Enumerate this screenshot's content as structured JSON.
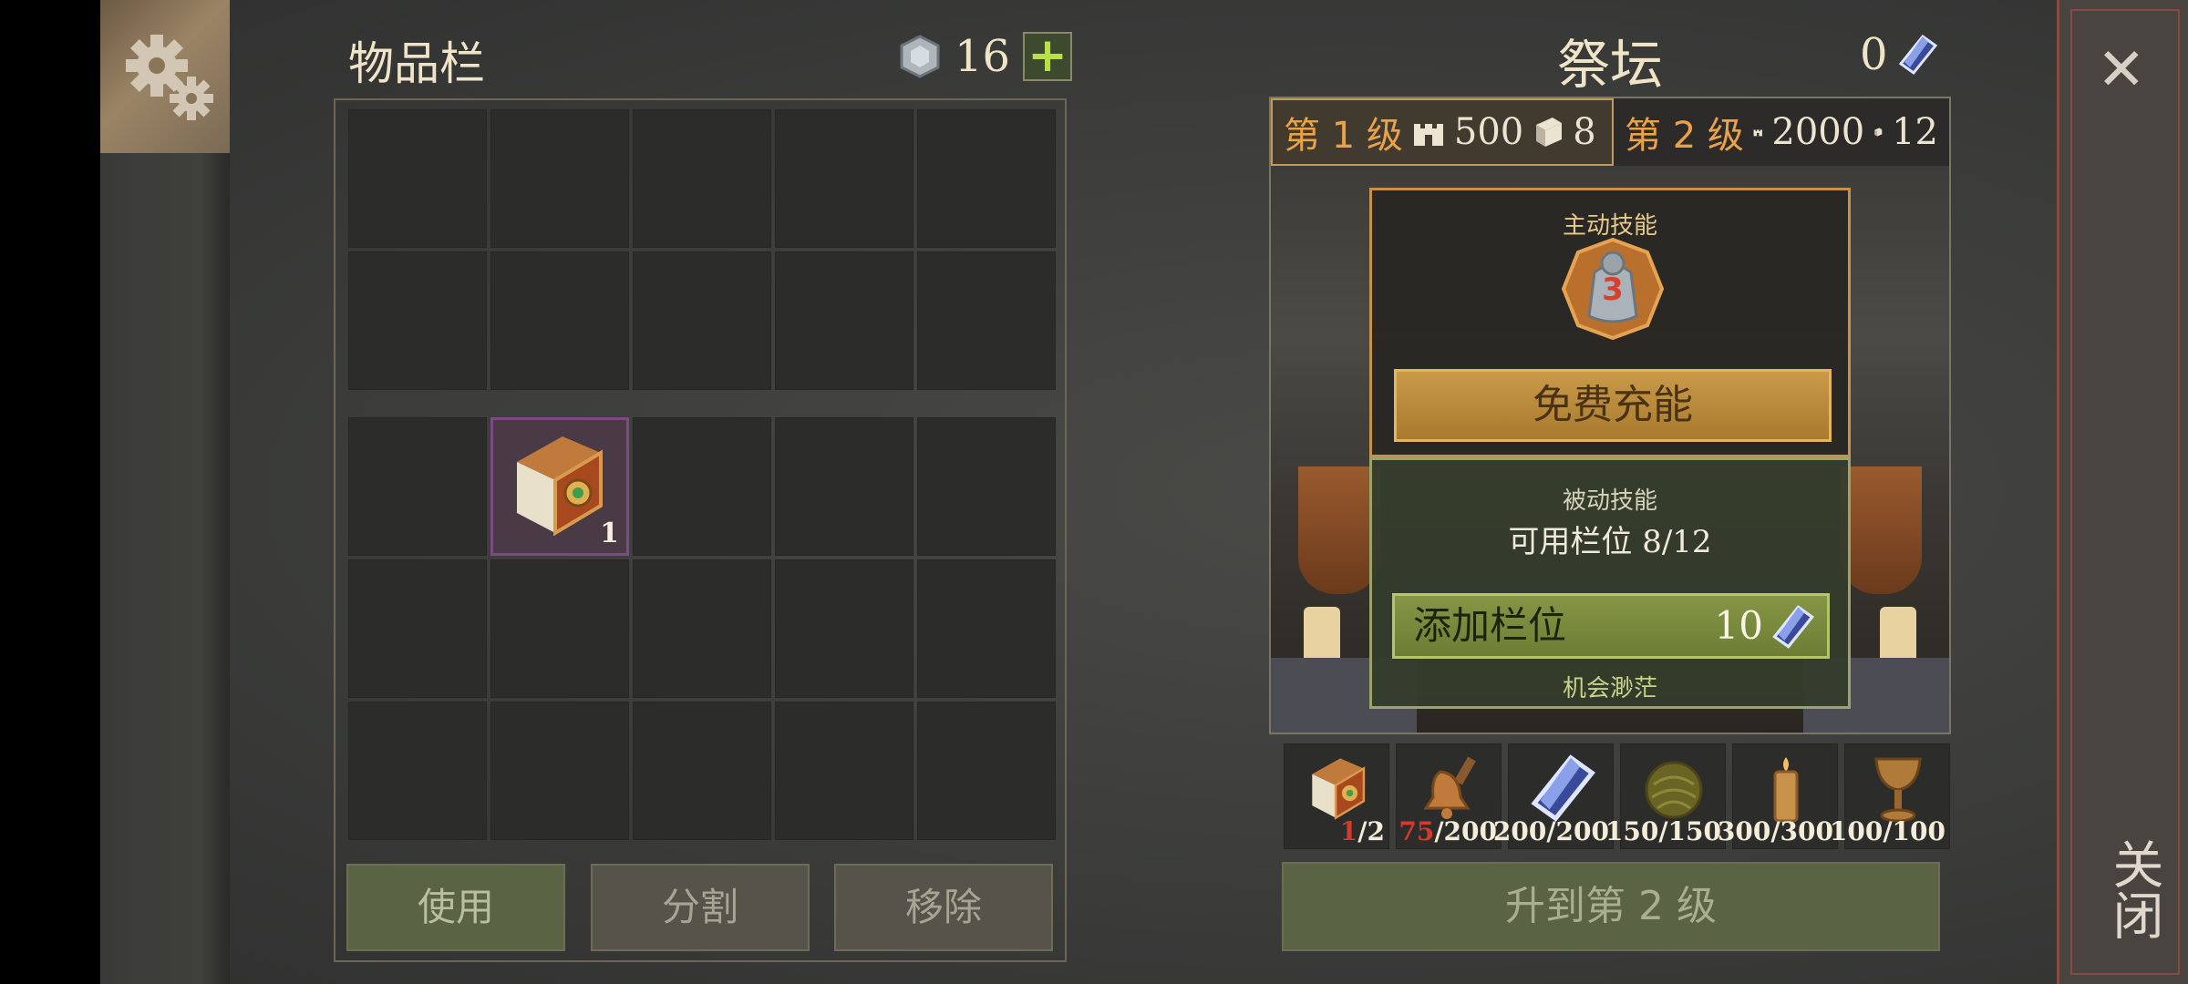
{
  "inventory": {
    "title": "物品栏",
    "gems": "16",
    "plus_label": "+",
    "book_qty": "1",
    "actions": {
      "use": "使用",
      "split": "分割",
      "remove": "移除"
    }
  },
  "altar": {
    "title": "祭坛",
    "crystals": "0",
    "levels": [
      {
        "label": "第 1 级",
        "castle": "500",
        "books": "8"
      },
      {
        "label": "第 2 级",
        "castle": "2000",
        "books": "12"
      }
    ],
    "active_label": "主动技能",
    "skill_level": "3",
    "recharge_label": "免费充能",
    "passive_label": "被动技能",
    "slots_text": "可用栏位 8/12",
    "add_slot_label": "添加栏位",
    "add_slot_cost": "10",
    "chance_text": "机会渺茫",
    "resources": [
      {
        "icon": "book-icon",
        "have": "1",
        "need": "/2",
        "short": true
      },
      {
        "icon": "bell-icon",
        "have": "75",
        "need": "/200",
        "short": true
      },
      {
        "icon": "crystal-icon",
        "have": "200",
        "need": "/200",
        "short": false
      },
      {
        "icon": "herb-ball-icon",
        "have": "150",
        "need": "/150",
        "short": false
      },
      {
        "icon": "candle-icon",
        "have": "300",
        "need": "/300",
        "short": false
      },
      {
        "icon": "goblet-icon",
        "have": "100",
        "need": "/100",
        "short": false
      }
    ],
    "levelup_label": "升到第 2 级"
  },
  "close": {
    "x": "✕",
    "label": "关闭"
  },
  "colors": {
    "accent_gold": "#c8904a",
    "shortage_red": "#d23a2a",
    "plus_green": "#b9e04b"
  }
}
